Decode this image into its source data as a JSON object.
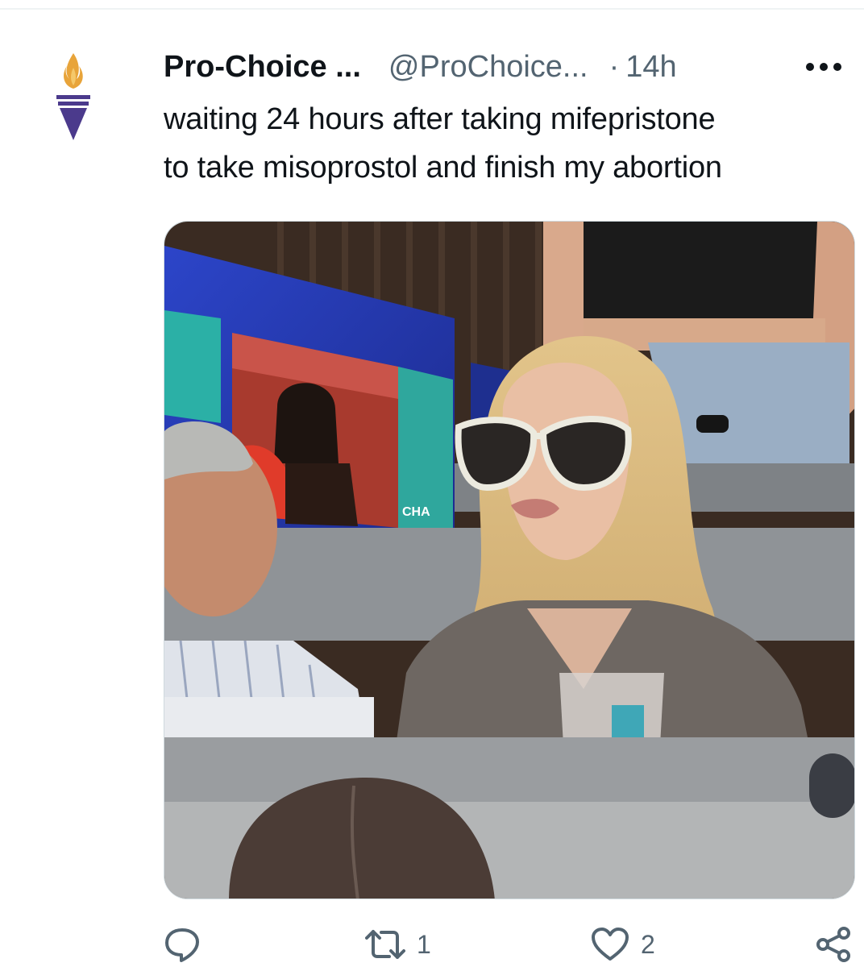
{
  "tweet": {
    "author_name": "Pro-Choice ...",
    "author_handle": "@ProChoice...",
    "separator": "·",
    "timestamp": "14h",
    "text_lines": [
      "waiting 24 hours after taking mifepristone",
      "to take misoprostol and finish my abortion"
    ]
  },
  "actions": {
    "reply_count": "",
    "retweet_count": "1",
    "like_count": "2"
  },
  "media": {
    "scoreboard_text": "CHA"
  },
  "colors": {
    "accent_torch": "#4b3a8c",
    "flame": "#e8a43a",
    "muted": "#536471"
  },
  "icons": [
    "torch-logo-icon",
    "more-options-icon",
    "reply-icon",
    "retweet-icon",
    "like-icon",
    "share-icon"
  ]
}
